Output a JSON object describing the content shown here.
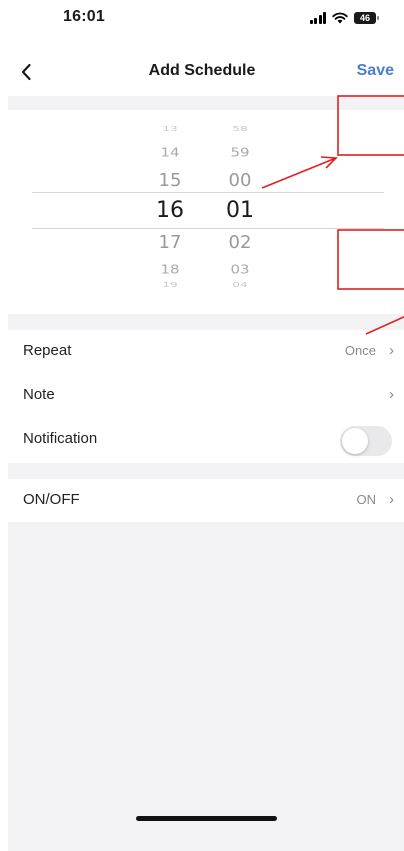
{
  "status_bar": {
    "time": "16:01",
    "battery": "46"
  },
  "nav": {
    "back_icon": "chevron-left-icon",
    "title": "Add Schedule",
    "save_label": "Save",
    "accent_color": "#4a7ec9"
  },
  "picker": {
    "hours": [
      "13",
      "14",
      "15",
      "16",
      "17",
      "18",
      "19"
    ],
    "minutes": [
      "58",
      "59",
      "00",
      "01",
      "02",
      "03",
      "04"
    ],
    "selected_hour": "16",
    "selected_minute": "01"
  },
  "settings": {
    "repeat": {
      "label": "Repeat",
      "value": "Once"
    },
    "note": {
      "label": "Note"
    },
    "notification": {
      "label": "Notification",
      "enabled": false
    },
    "on_off": {
      "label": "ON/OFF",
      "value": "ON"
    }
  },
  "annotations": {
    "color": "#e0201f"
  }
}
